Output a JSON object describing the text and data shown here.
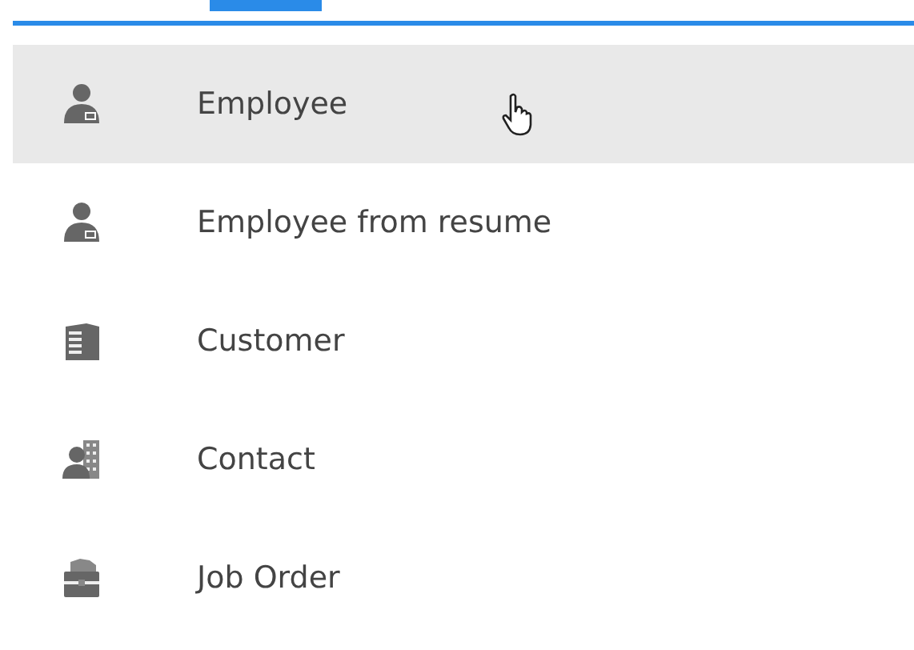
{
  "menu": {
    "items": [
      {
        "label": "Employee",
        "kind": "employee",
        "selected": true
      },
      {
        "label": "Employee from resume",
        "kind": "employee",
        "selected": false
      },
      {
        "label": "Customer",
        "kind": "customer",
        "selected": false
      },
      {
        "label": "Contact",
        "kind": "contact",
        "selected": false
      },
      {
        "label": "Job Order",
        "kind": "job-order",
        "selected": false
      }
    ]
  }
}
